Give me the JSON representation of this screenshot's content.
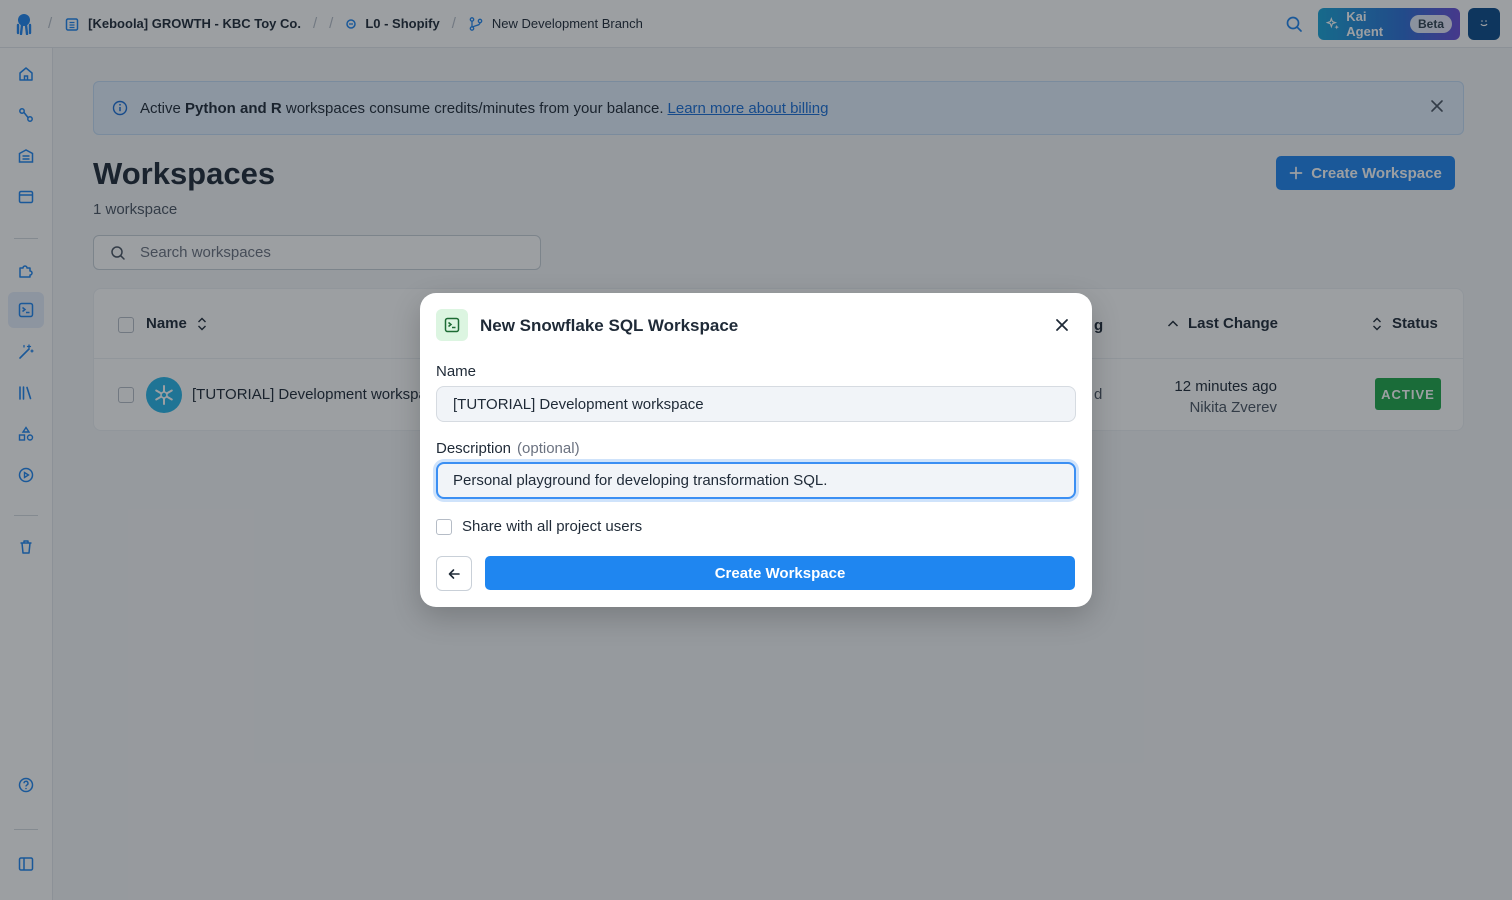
{
  "topbar": {
    "project": "[Keboola] GROWTH - KBC Toy Co.",
    "component": "L0 - Shopify",
    "branch": "New Development Branch",
    "kai_label": "Kai Agent",
    "kai_badge": "Beta"
  },
  "banner": {
    "text_prefix": "Active ",
    "text_bold": "Python and R",
    "text_suffix": " workspaces consume credits/minutes from your balance.",
    "link": "Learn more about billing"
  },
  "page": {
    "title": "Workspaces",
    "count": "1 workspace",
    "create_button": "Create Workspace",
    "search_placeholder": "Search workspaces"
  },
  "table": {
    "columns": {
      "name": "Name",
      "last_change": "Last Change",
      "status": "Status"
    },
    "hidden_header_fragment": "g",
    "hidden_cell_fragment": "d",
    "rows": [
      {
        "name": "[TUTORIAL] Development workspa",
        "last_change": "12 minutes ago",
        "changed_by": "Nikita Zverev",
        "status": "ACTIVE"
      }
    ]
  },
  "modal": {
    "title": "New Snowflake SQL Workspace",
    "name_label": "Name",
    "name_value": "[TUTORIAL] Development workspace",
    "description_label": "Description",
    "description_optional": "(optional)",
    "description_value": "Personal playground for developing transformation SQL.",
    "share_label": "Share with all project users",
    "submit_label": "Create Workspace"
  },
  "colors": {
    "primary": "#1f86f0",
    "status_active": "#1fa84a",
    "banner_bg": "#e4f0fd",
    "snowflake": "#29b5e8"
  }
}
